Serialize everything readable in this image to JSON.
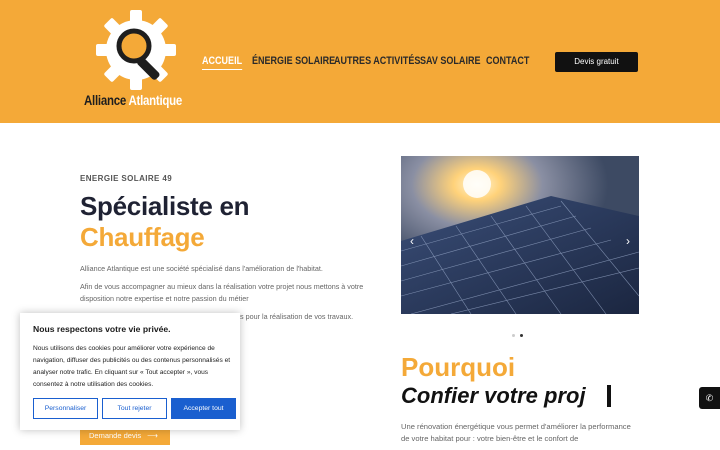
{
  "brand": {
    "name_part1": "Alliance",
    "name_part2": "Atlantique",
    "colors": {
      "accent": "#f4a938",
      "dark": "#1f2233",
      "primary_blue": "#1a5fcf"
    }
  },
  "nav": {
    "items": [
      {
        "label": "ACCUEIL",
        "active": true
      },
      {
        "label": "ÉNERGIE SOLAIRE"
      },
      {
        "label": "AUTRES ACTIVITÉS"
      },
      {
        "label": "SAV SOLAIRE"
      },
      {
        "label": "CONTACT"
      }
    ],
    "cta_label": "Devis gratuit"
  },
  "hero": {
    "eyebrow": "ENERGIE SOLAIRE 49",
    "title_line1": "Spécialiste en",
    "title_line2": "Chauffage",
    "para1": "Alliance Atlantique est une société spécialisé dans l'amélioration de l'habitat.",
    "para2": "Afin de vous accompagner au mieux dans la réalisation votre projet nous mettons à votre disposition notre expertise et notre passion du métier",
    "para3_visible": "s pour la réalisation de vos travaux.",
    "button_label": "Demande devis",
    "button_icon": "arrow-right-icon"
  },
  "slider": {
    "prev_icon": "chevron-left-icon",
    "next_icon": "chevron-right-icon",
    "dots": [
      {
        "active": false
      },
      {
        "active": true
      }
    ]
  },
  "why": {
    "title_line1": "Pourquoi",
    "title_line2": "Confier votre proj",
    "para": "Une rénovation énergétique vous permet d'améliorer la performance de votre habitat pour : votre bien-être et le confort de"
  },
  "cookie": {
    "title": "Nous respectons votre vie privée.",
    "text": "Nous utilisons des cookies pour améliorer votre expérience de navigation, diffuser des publicités ou des contenus personnalisés et analyser notre trafic. En cliquant sur « Tout accepter », vous consentez à notre utilisation des cookies.",
    "btn_customize": "Personnaliser",
    "btn_reject": "Tout rejeter",
    "btn_accept": "Accepter tout"
  },
  "floating": {
    "phone_icon": "phone-icon"
  }
}
